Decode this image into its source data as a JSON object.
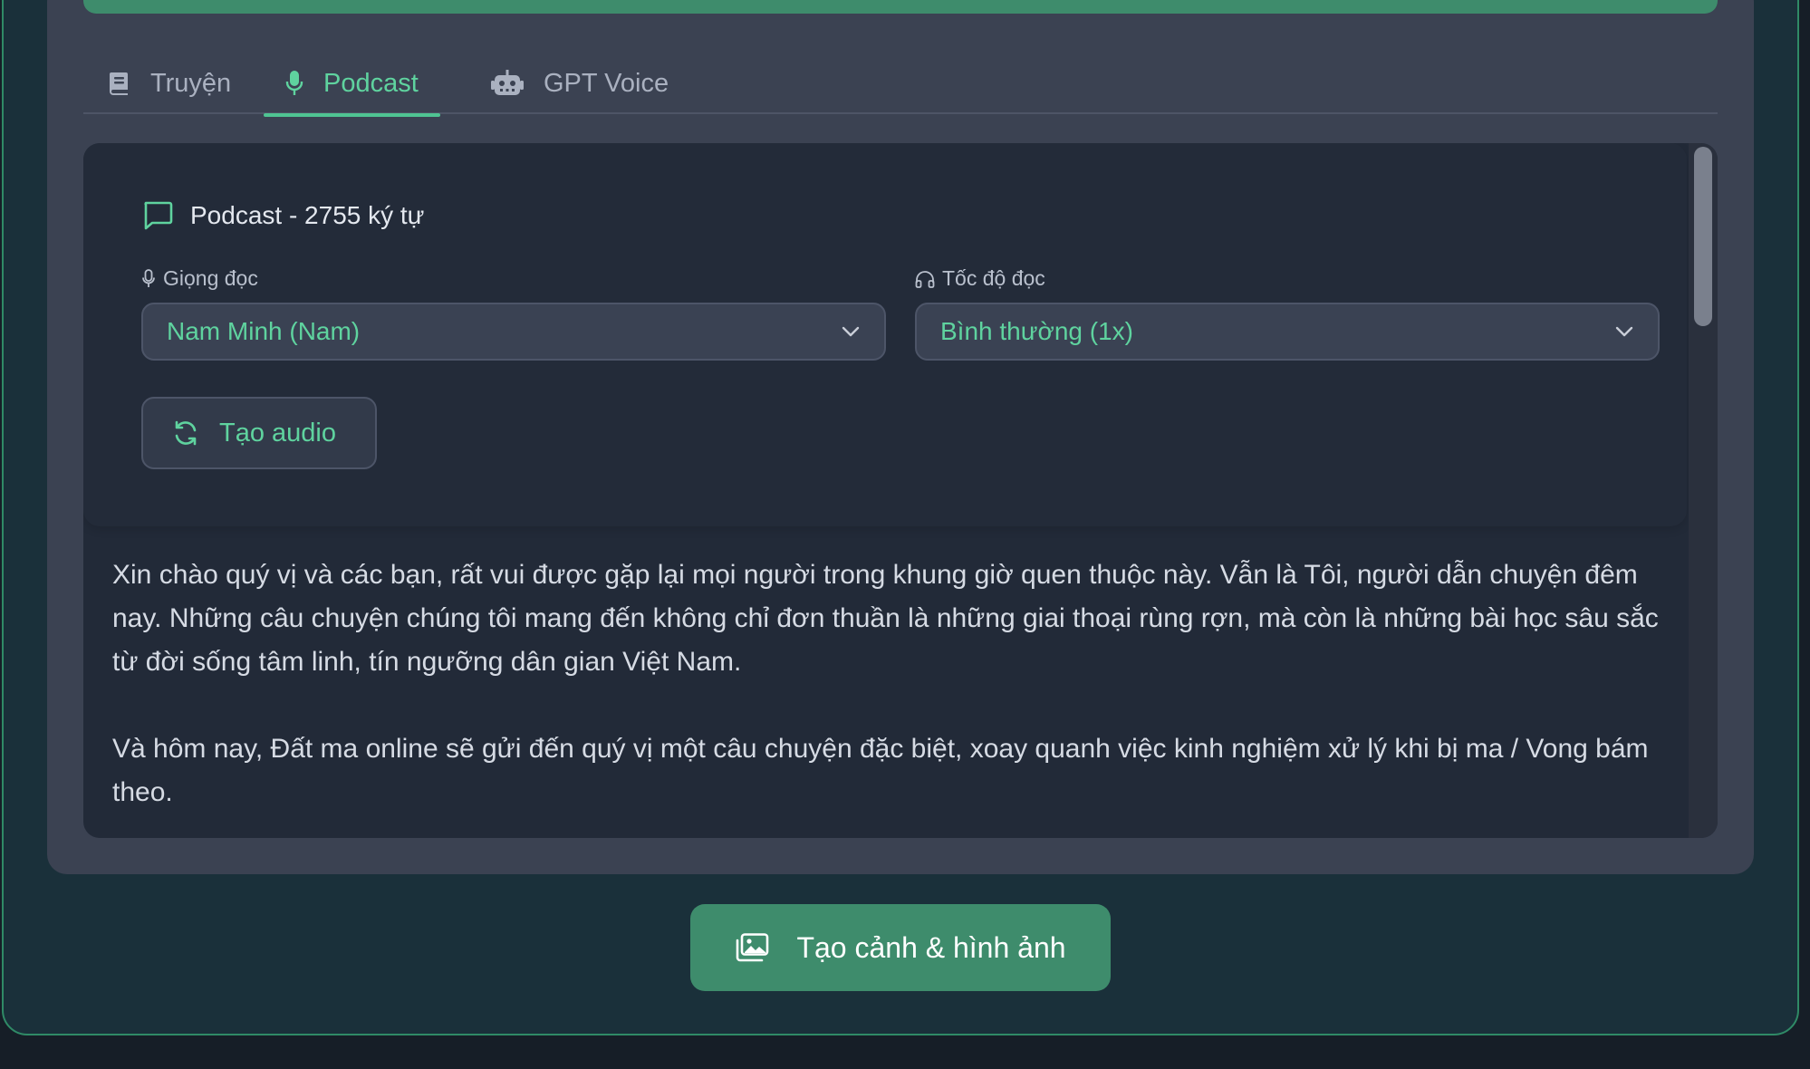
{
  "tabs": [
    {
      "label": "Truyện",
      "icon": "book-icon",
      "active": false
    },
    {
      "label": "Podcast",
      "icon": "microphone-icon",
      "active": true
    },
    {
      "label": "GPT Voice",
      "icon": "robot-icon",
      "active": false
    }
  ],
  "settings": {
    "title": "Podcast - 2755 ký tự",
    "voice_label": "Giọng đọc",
    "voice_value": "Nam Minh (Nam)",
    "speed_label": "Tốc độ đọc",
    "speed_value": "Bình thường (1x)",
    "generate_audio_label": "Tạo audio"
  },
  "content": {
    "paragraphs": [
      "Xin chào quý vị và các bạn, rất vui được gặp lại mọi người trong khung giờ quen thuộc này. Vẫn là Tôi, người dẫn chuyện đêm nay. Những câu chuyện chúng tôi mang đến không chỉ đơn thuần là những giai thoại rùng rợn, mà còn là những bài học sâu sắc từ đời sống tâm linh, tín ngưỡng dân gian Việt Nam.",
      "Và hôm nay, Đất ma online sẽ gửi đến quý vị một câu chuyện đặc biệt, xoay quanh việc kinh nghiệm xử lý khi bị ma / Vong bám theo."
    ]
  },
  "actions": {
    "create_scenes_label": "Tạo cảnh & hình ảnh"
  },
  "colors": {
    "accent": "#5fd39f",
    "primary": "#3e8c6c",
    "background": "#1a303a",
    "card": "#3b4252",
    "panel": "#222a38"
  }
}
